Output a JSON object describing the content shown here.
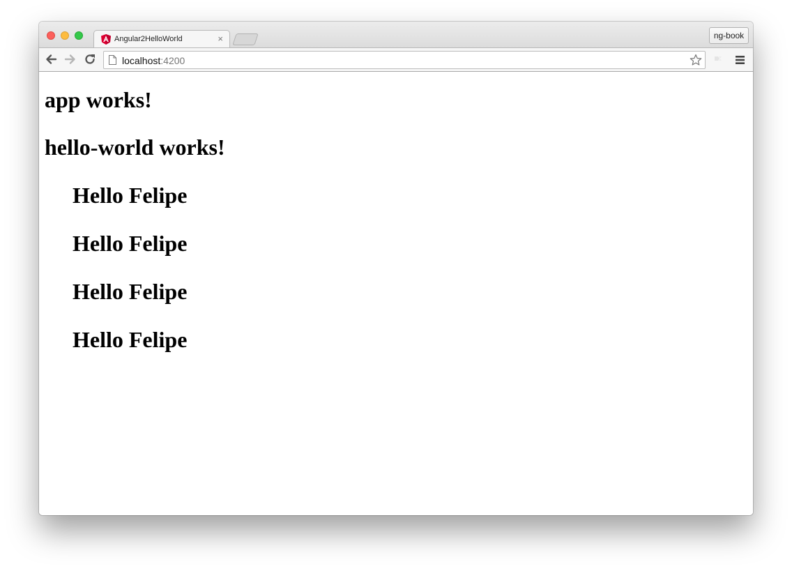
{
  "browser": {
    "tab": {
      "title": "Angular2HelloWorld",
      "close_glyph": "×",
      "favicon": "angular-icon",
      "favicon_color": "#dd0031"
    },
    "profile_button": "ng-book",
    "address_bar": {
      "host": "localhost",
      "port": ":4200"
    },
    "icons": {
      "back": "arrow-left-icon",
      "forward": "arrow-right-icon",
      "reload": "reload-icon",
      "page": "page-icon",
      "bookmark": "star-icon",
      "extension": "extension-icon",
      "menu": "hamburger-menu-icon"
    },
    "traffic_lights": {
      "close": "#fc605c",
      "minimize": "#fdbc40",
      "maximize": "#34c84a"
    }
  },
  "page": {
    "app_heading": "app works!",
    "hello_world_heading": "hello-world works!",
    "greetings": [
      "Hello Felipe",
      "Hello Felipe",
      "Hello Felipe",
      "Hello Felipe"
    ]
  }
}
